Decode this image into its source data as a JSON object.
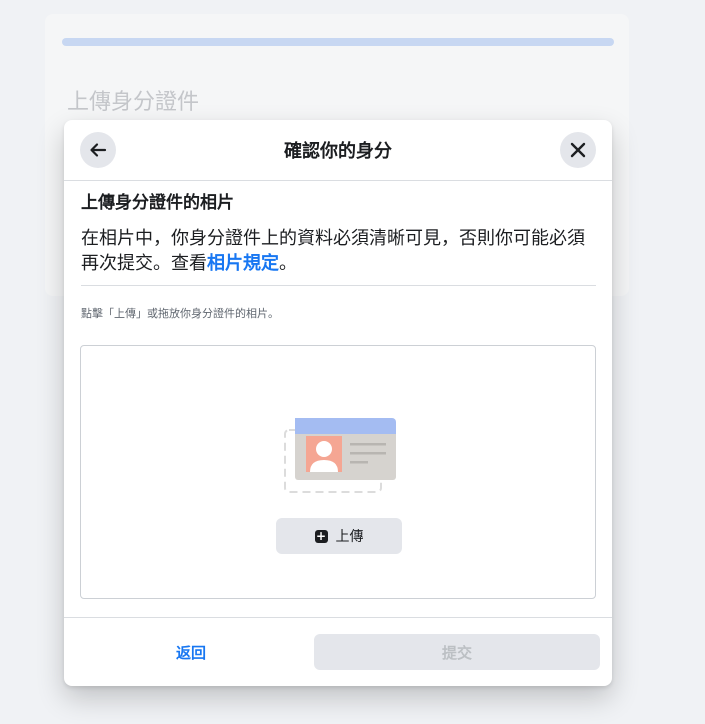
{
  "background": {
    "title": "上傳身分證件"
  },
  "modal": {
    "title": "確認你的身分",
    "back_icon": "arrow-left-icon",
    "close_icon": "close-icon",
    "section_title": "上傳身分證件的相片",
    "description": "在相片中，你身分證件上的資料必須清晰可見，否則你可能必須再次提交。查看",
    "description_link": "相片規定",
    "description_end": "。",
    "hint": "點擊「上傳」或拖放你身分證件的相片。",
    "upload_label": "上傳",
    "upload_icon": "plus-square-icon",
    "footer_back": "返回",
    "submit": "提交"
  },
  "colors": {
    "accent": "#1877f2",
    "card_header": "#a4bcf2",
    "photo_bg": "#f5a693",
    "card_body": "#d6d3cf"
  }
}
